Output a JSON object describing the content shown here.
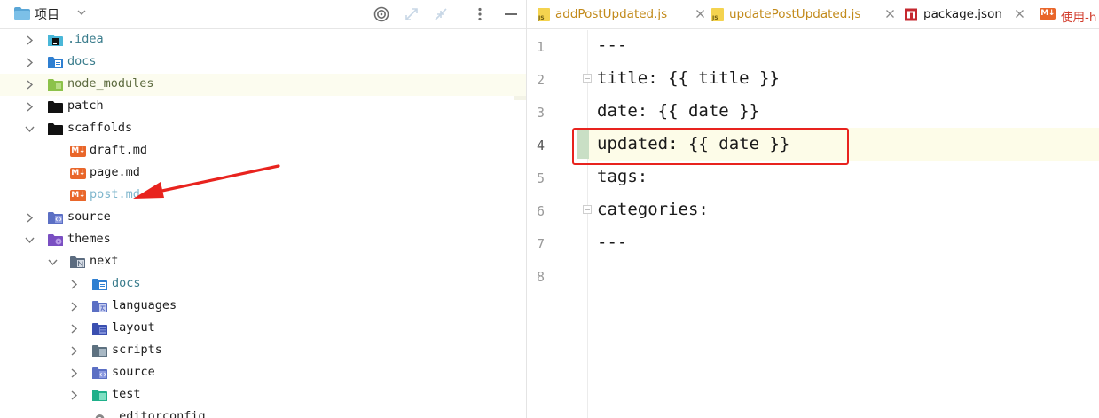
{
  "project_panel": {
    "title": "项目",
    "tree": [
      {
        "label": ".idea",
        "icon": "idea-folder-icon",
        "expanded": false
      },
      {
        "label": "docs",
        "icon": "docs-folder-icon",
        "expanded": false
      },
      {
        "label": "node_modules",
        "icon": "node-modules-folder-icon",
        "expanded": false
      },
      {
        "label": "patch",
        "icon": "folder-icon",
        "expanded": false
      },
      {
        "label": "scaffolds",
        "icon": "folder-icon",
        "expanded": true
      },
      {
        "label": "draft.md",
        "icon": "markdown-file-icon"
      },
      {
        "label": "page.md",
        "icon": "markdown-file-icon"
      },
      {
        "label": "post.md",
        "icon": "markdown-file-icon"
      },
      {
        "label": "source",
        "icon": "source-folder-icon",
        "expanded": false
      },
      {
        "label": "themes",
        "icon": "themes-folder-icon",
        "expanded": true
      },
      {
        "label": "next",
        "icon": "next-folder-icon",
        "expanded": true
      },
      {
        "label": "docs",
        "icon": "docs-folder-icon",
        "expanded": false
      },
      {
        "label": "languages",
        "icon": "languages-folder-icon",
        "expanded": false
      },
      {
        "label": "layout",
        "icon": "layout-folder-icon",
        "expanded": false
      },
      {
        "label": "scripts",
        "icon": "scripts-folder-icon",
        "expanded": false
      },
      {
        "label": "source",
        "icon": "source-folder-icon",
        "expanded": false
      },
      {
        "label": "test",
        "icon": "test-folder-icon",
        "expanded": false
      },
      {
        "label": ".editorconfig",
        "icon": "editorconfig-file-icon"
      }
    ]
  },
  "editor": {
    "tabs": [
      {
        "label": "addPostUpdated.js",
        "icon": "js-file-icon"
      },
      {
        "label": "updatePostUpdated.js",
        "icon": "js-file-icon"
      },
      {
        "label": "package.json",
        "icon": "npm-icon"
      },
      {
        "label": "使用-h",
        "icon": "markdown-file-icon"
      }
    ],
    "line_numbers": [
      "1",
      "2",
      "3",
      "4",
      "5",
      "6",
      "7",
      "8"
    ],
    "lines": [
      "---",
      "title: {{ title }}",
      "date: {{ date }}",
      "updated: {{ date }}",
      "tags:",
      "categories:",
      "---",
      ""
    ],
    "current_line": 4
  },
  "colors": {
    "annotation": "#e8231e",
    "markdown_badge": "#e9662a",
    "selected_row": "#fcfcef"
  },
  "markdown_badge_text": "M↓"
}
